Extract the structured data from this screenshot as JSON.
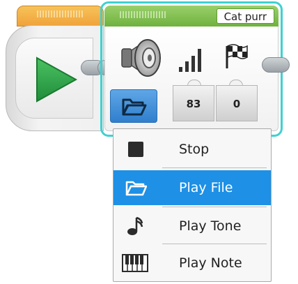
{
  "start_block": {
    "icons": [
      "play-icon"
    ]
  },
  "sound_block": {
    "file_name": "Cat purr",
    "icons": [
      "speaker-icon",
      "volume-bars-icon",
      "checkered-flag-icon",
      "folder-icon"
    ],
    "params": {
      "volume": "83",
      "play_type": "0"
    }
  },
  "mode_menu": {
    "items": [
      {
        "label": "Stop",
        "icon": "stop-square-icon",
        "selected": false
      },
      {
        "label": "Play File",
        "icon": "folder-icon",
        "selected": true
      },
      {
        "label": "Play Tone",
        "icon": "music-note-icon",
        "selected": false
      },
      {
        "label": "Play Note",
        "icon": "piano-keys-icon",
        "selected": false
      }
    ]
  },
  "colors": {
    "start_header": "#f0a23a",
    "sound_header": "#6fb13f",
    "selection_outline": "#3fd1d1",
    "menu_selected": "#1e90e6",
    "play_icon": "#2fa84a"
  }
}
